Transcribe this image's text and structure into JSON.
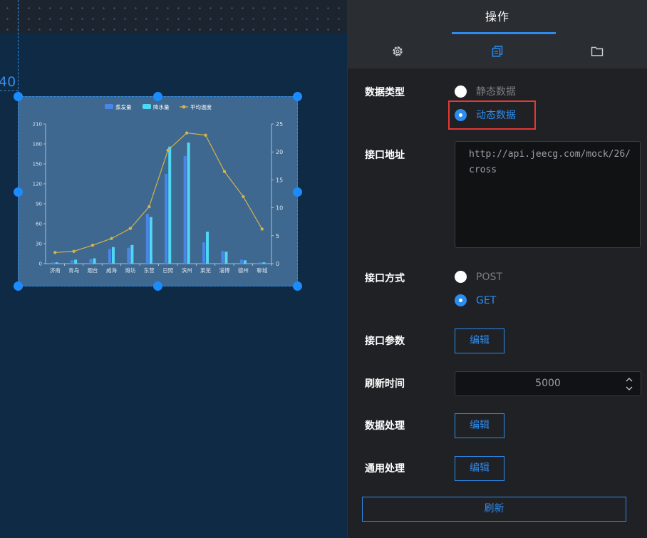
{
  "canvas": {
    "coord_label": "40",
    "chart": {
      "legend": [
        "蒸发量",
        "降水量",
        "平均温度"
      ]
    }
  },
  "panel": {
    "title": "操作",
    "tabs": [
      {
        "icon": "gear-icon",
        "active": false
      },
      {
        "icon": "copy-icon",
        "active": true
      },
      {
        "icon": "folder-icon",
        "active": false
      }
    ],
    "data_type": {
      "label": "数据类型",
      "options": [
        "静态数据",
        "动态数据"
      ],
      "selected": "动态数据"
    },
    "api_url": {
      "label": "接口地址",
      "value": "http://api.jeecg.com/mock/26/cross"
    },
    "api_method": {
      "label": "接口方式",
      "options": [
        "POST",
        "GET"
      ],
      "selected": "GET"
    },
    "api_params": {
      "label": "接口参数",
      "button": "编辑"
    },
    "refresh_time": {
      "label": "刷新时间",
      "value": "5000"
    },
    "data_processing": {
      "label": "数据处理",
      "button": "编辑"
    },
    "common_processing": {
      "label": "通用处理",
      "button": "编辑"
    },
    "refresh_button": "刷新"
  },
  "colors": {
    "accent": "#2d8cf0",
    "highlight_box": "#e53935",
    "series_evaporation": "#4a86e8",
    "series_precipitation": "#4fd8f5",
    "series_temperature": "#d4b34a"
  },
  "chart_data": {
    "type": "bar",
    "categories": [
      "济南",
      "青岛",
      "烟台",
      "威海",
      "潍坊",
      "东营",
      "日照",
      "滨州",
      "莱芜",
      "淄博",
      "德州",
      "聊城"
    ],
    "series": [
      {
        "name": "蒸发量",
        "type": "bar",
        "axis": "left",
        "values": [
          2,
          5,
          7,
          22,
          24,
          75,
          135,
          162,
          32,
          19,
          6,
          2
        ]
      },
      {
        "name": "降水量",
        "type": "bar",
        "axis": "left",
        "values": [
          2,
          6,
          8,
          25,
          28,
          70,
          176,
          182,
          48,
          18,
          5,
          2
        ]
      },
      {
        "name": "平均温度",
        "type": "line",
        "axis": "right",
        "values": [
          2.0,
          2.2,
          3.3,
          4.5,
          6.3,
          10.2,
          20.3,
          23.4,
          23.0,
          16.5,
          12.0,
          6.2
        ]
      }
    ],
    "y_left": {
      "min": 0,
      "max": 210,
      "ticks": [
        0,
        30,
        60,
        90,
        120,
        150,
        180,
        210
      ]
    },
    "y_right": {
      "min": 0,
      "max": 25,
      "ticks": [
        0,
        5,
        10,
        15,
        20,
        25
      ]
    },
    "legend_position": "top-center",
    "grid": false
  }
}
